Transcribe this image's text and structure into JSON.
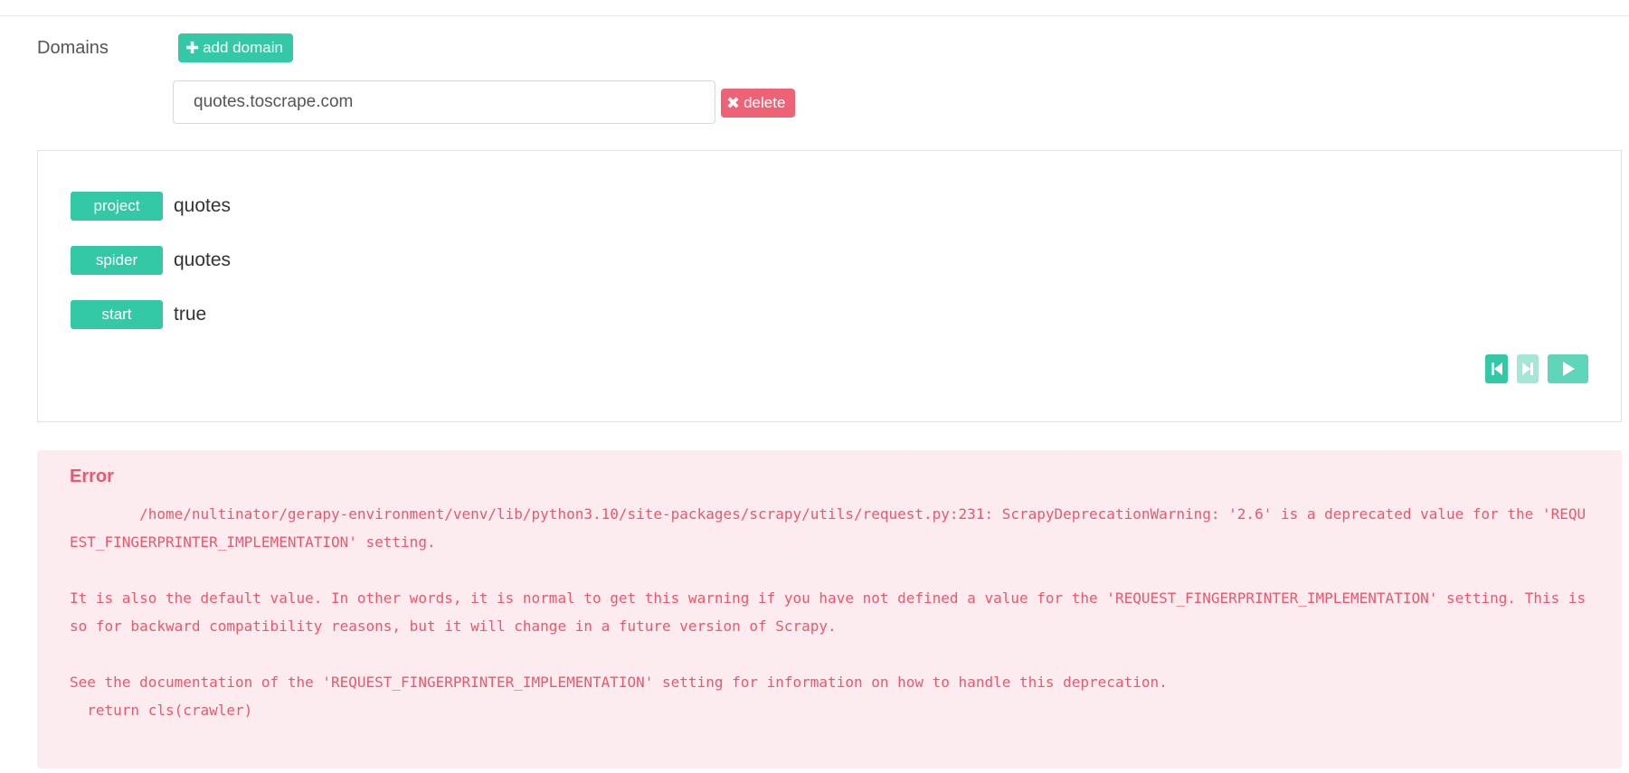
{
  "domains": {
    "label": "Domains",
    "add_button_label": "add domain",
    "add_icon": "plus-icon",
    "entries": [
      {
        "value": "quotes.toscrape.com",
        "delete_label": "delete",
        "delete_icon": "times-icon"
      }
    ]
  },
  "details": {
    "rows": [
      {
        "key": "project",
        "value": "quotes"
      },
      {
        "key": "spider",
        "value": "quotes"
      },
      {
        "key": "start",
        "value": "true"
      }
    ],
    "controls": [
      {
        "icon": "skip-first-icon"
      },
      {
        "icon": "skip-last-icon"
      },
      {
        "icon": "play-icon"
      }
    ]
  },
  "error": {
    "title": "Error",
    "message": "        /home/nultinator/gerapy-environment/venv/lib/python3.10/site-packages/scrapy/utils/request.py:231: ScrapyDeprecationWarning: '2.6' is a deprecated value for the 'REQUEST_FINGERPRINTER_IMPLEMENTATION' setting.\n\nIt is also the default value. In other words, it is normal to get this warning if you have not defined a value for the 'REQUEST_FINGERPRINTER_IMPLEMENTATION' setting. This is so for backward compatibility reasons, but it will change in a future version of Scrapy.\n\nSee the documentation of the 'REQUEST_FINGERPRINTER_IMPLEMENTATION' setting for information on how to handle this deprecation.\n  return cls(crawler)"
  },
  "colors": {
    "primary": "#34c9a6",
    "danger": "#ee6276",
    "error_text": "#e8596d",
    "error_bg": "#fdecef"
  }
}
